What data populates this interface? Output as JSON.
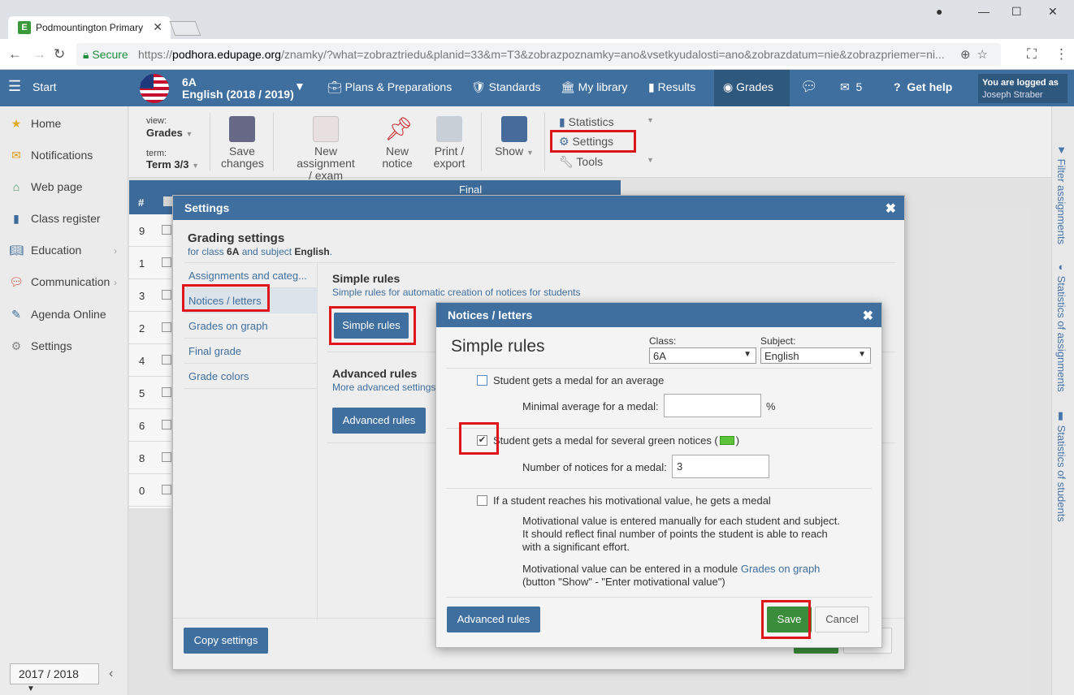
{
  "browser": {
    "tab_title": "Podmountington Primary",
    "secure_label": "Secure",
    "url_scheme": "https://",
    "url_domain": "podhora.edupage.org",
    "url_path": "/znamky/?what=zobraztriedu&planid=33&m=T3&zobrazpoznamky=ano&vsetkyudalosti=ano&zobrazdatum=nie&zobrazpriemer=ni..."
  },
  "appbar": {
    "start_label": "Start",
    "class_name": "6A",
    "subject_year": "English (2018 / 2019)",
    "plans_label": "Plans & Preparations",
    "standards_label": "Standards",
    "library_label": "My library",
    "results_label": "Results",
    "grades_label": "Grades",
    "messages_count": "5",
    "help_label": "Get help",
    "logged_label": "You are logged as",
    "user_name": "Joseph Straber"
  },
  "sidebar": {
    "items": [
      {
        "label": "Home",
        "icon": "star-icon"
      },
      {
        "label": "Notifications",
        "icon": "envelope-icon"
      },
      {
        "label": "Web page",
        "icon": "house-icon"
      },
      {
        "label": "Class register",
        "icon": "book-icon"
      },
      {
        "label": "Education",
        "icon": "open-book-icon"
      },
      {
        "label": "Communication",
        "icon": "chat-icon"
      },
      {
        "label": "Agenda Online",
        "icon": "pen-icon"
      },
      {
        "label": "Settings",
        "icon": "gear-icon"
      }
    ],
    "year": "2017 / 2018"
  },
  "toolbar": {
    "view_label": "view:",
    "view_value": "Grades",
    "term_label": "term:",
    "term_value": "Term 3/3",
    "save_label_1": "Save",
    "save_label_2": "changes",
    "new_assign_1": "New assignment",
    "new_assign_2": "/ exam",
    "new_notice_1": "New",
    "new_notice_2": "notice",
    "print_1": "Print /",
    "print_2": "export",
    "show_label": "Show",
    "statistics_label": "Statistics",
    "settings_label": "Settings",
    "tools_label": "Tools"
  },
  "rightbar": {
    "filter_label": "Filter assignments",
    "stats_assign_label": "Statistics of assignments",
    "stats_students_label": "Statistics of students"
  },
  "grid": {
    "col_hash": "#",
    "final_label": "Final",
    "rows": [
      "9",
      "1",
      "3",
      "2",
      "4",
      "5",
      "6",
      "8",
      "0"
    ]
  },
  "settings_dialog": {
    "title": "Settings",
    "heading": "Grading settings",
    "sub_prefix": "for class ",
    "sub_class": "6A",
    "sub_middle": " and subject ",
    "sub_subject": "English",
    "sub_end": ".",
    "menu": [
      "Assignments and categ...",
      "Notices / letters",
      "Grades on graph",
      "Final grade",
      "Grade colors"
    ],
    "simple_heading": "Simple rules",
    "simple_sub": "Simple rules for automatic creation of notices for students",
    "simple_btn": "Simple rules",
    "advanced_heading": "Advanced rules",
    "advanced_sub": "More advanced settings",
    "advanced_btn": "Advanced rules",
    "copy_btn": "Copy settings"
  },
  "notices_dialog": {
    "title": "Notices / letters",
    "heading": "Simple rules",
    "class_label": "Class:",
    "class_value": "6A",
    "subject_label": "Subject:",
    "subject_value": "English",
    "rule1_label": "Student gets a medal for an average",
    "rule1_checked": false,
    "rule1_field_label": "Minimal average for a medal:",
    "rule1_value": "",
    "rule1_unit": "%",
    "rule2_label": "Student gets a medal for several green notices (",
    "rule2_label_end": ")",
    "rule2_checked": true,
    "rule2_field_label": "Number of notices for a medal:",
    "rule2_value": "3",
    "rule3_label": "If a student reaches his motivational value, he gets a medal",
    "rule3_checked": false,
    "para1": "Motivational value is entered manually for each student and subject. It should reflect final number of points the student is able to reach with a significant effort.",
    "para2_prefix": "Motivational value can be entered in a module ",
    "para2_link": "Grades on graph",
    "para2_suffix": "(button \"Show\" - \"Enter motivational value\")",
    "advanced_btn": "Advanced rules",
    "save_btn": "Save",
    "cancel_btn": "Cancel"
  },
  "colors": {
    "brand_blue": "#3e6f9e",
    "highlight_red": "#e0151b",
    "save_green": "#3a8d3a"
  }
}
